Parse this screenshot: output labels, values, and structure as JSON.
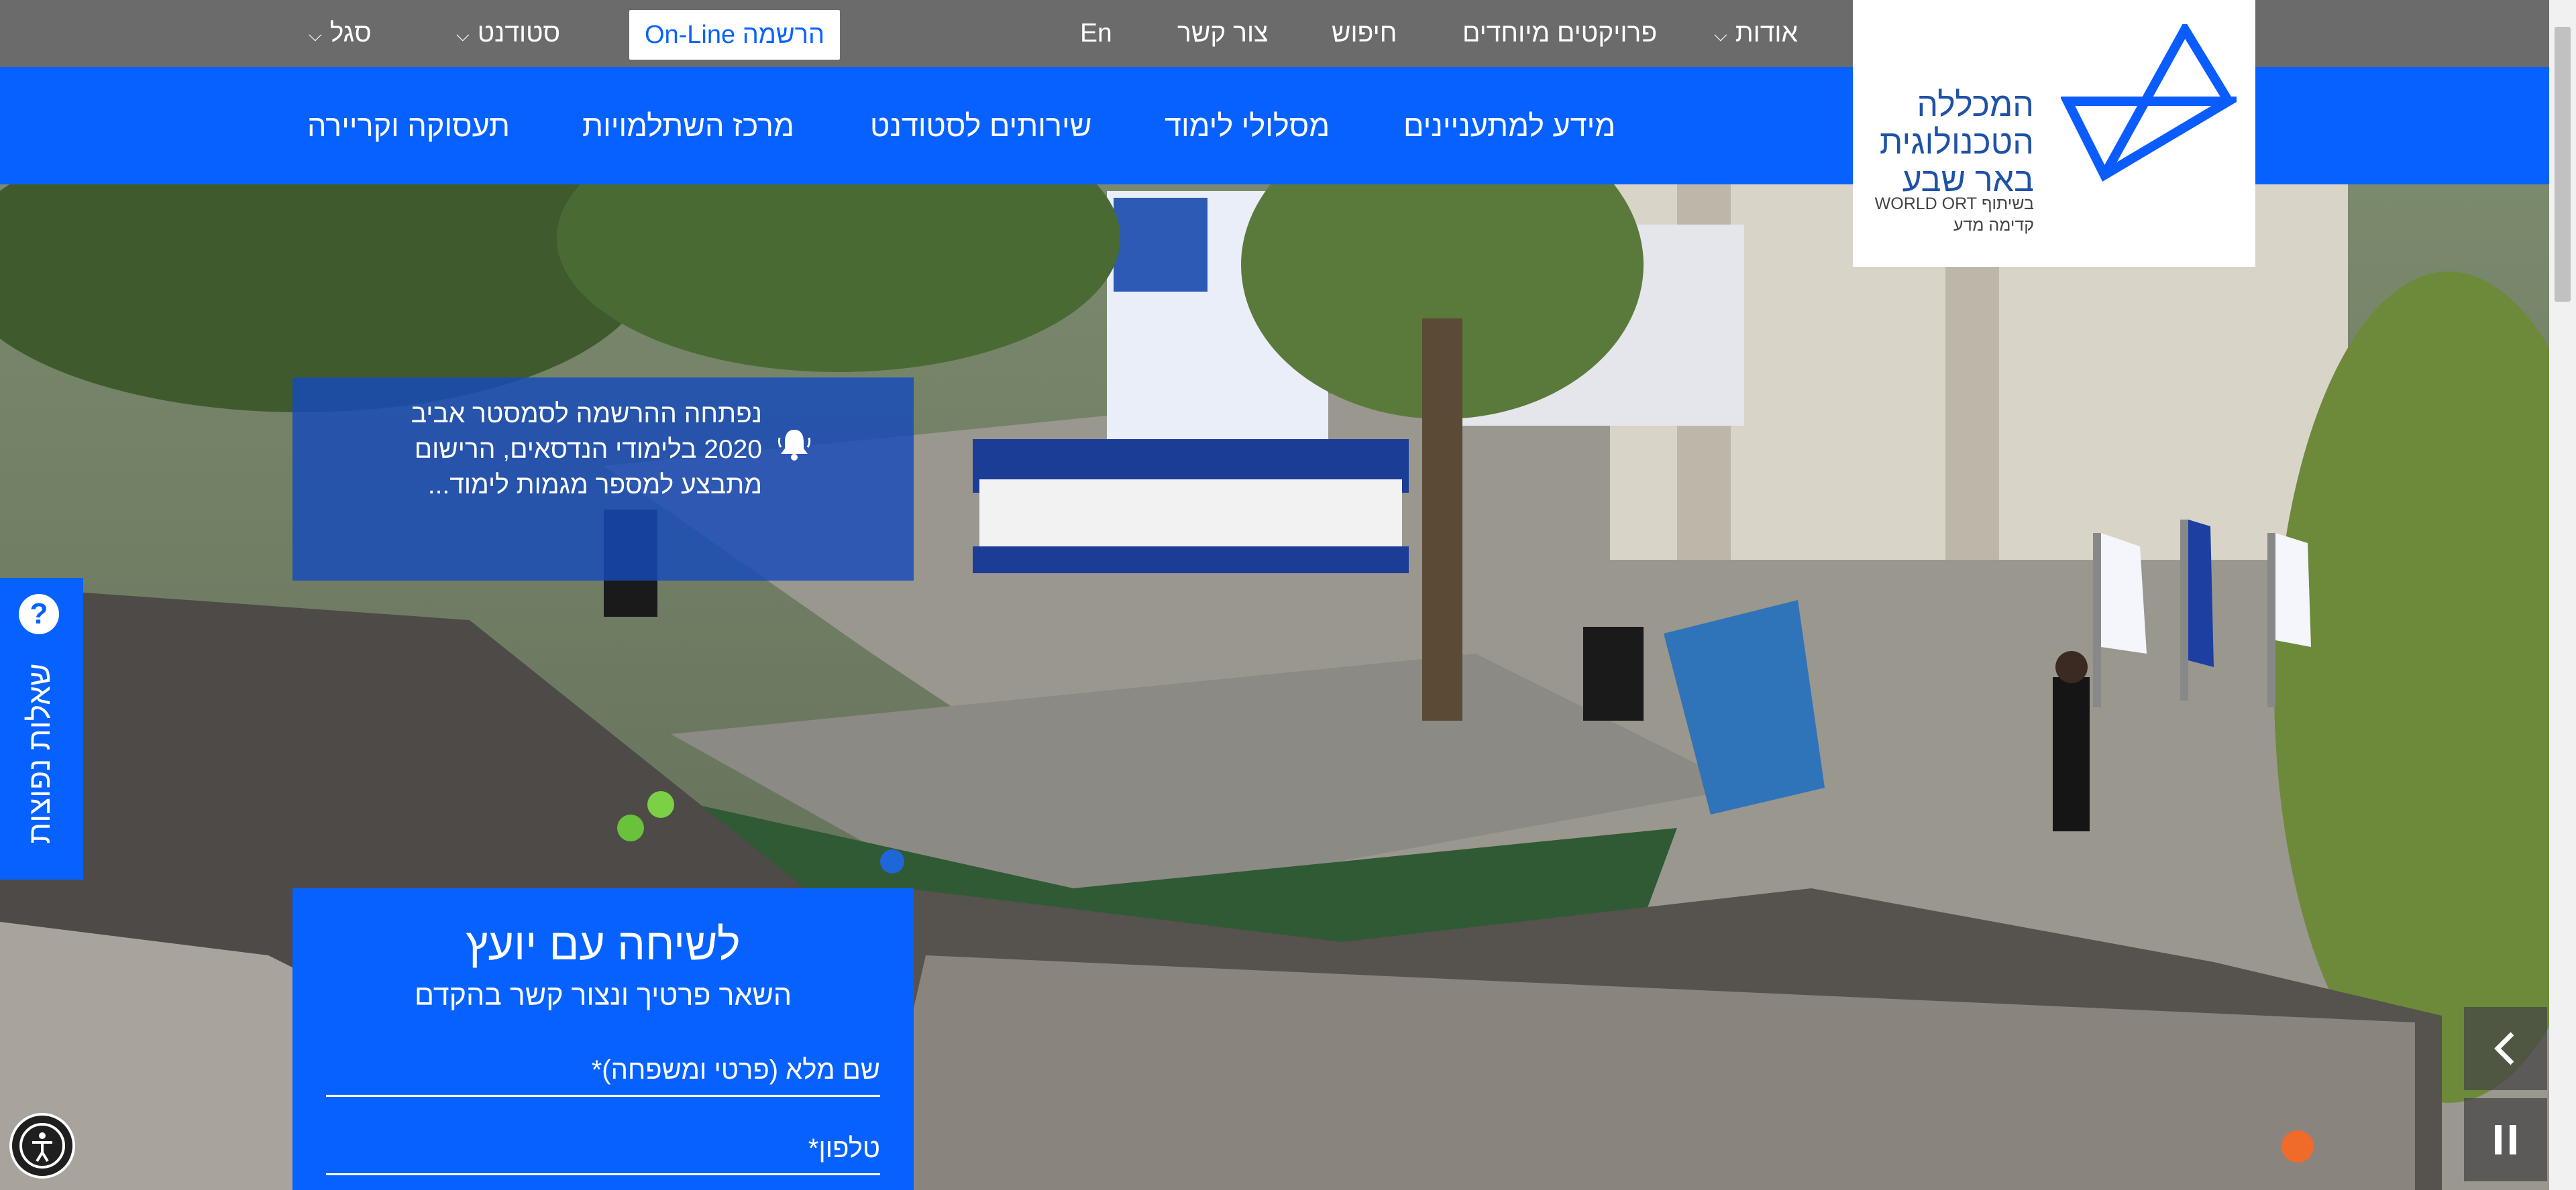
{
  "topbar": {
    "about": "אודות",
    "special_projects": "פרויקטים מיוחדים",
    "search": "חיפוש",
    "contact": "צור קשר",
    "english": "En",
    "online_registration": "הרשמה On-Line",
    "student": "סטודנט",
    "staff": "סגל"
  },
  "nav": {
    "prospective": "מידע למתעניינים",
    "study_tracks": "מסלולי לימוד",
    "student_services": "שירותים לסטודנט",
    "training_center": "מרכז השתלמויות",
    "careers": "תעסוקה וקריירה"
  },
  "logo": {
    "line1": "המכללה",
    "line2": "הטכנולוגית",
    "line3": "באר שבע",
    "partner_line1": "בשיתוף WORLD ORT",
    "partner_line2": "קדימה מדע"
  },
  "announcement": {
    "text": "נפתחה ההרשמה לסמסטר אביב 2020  בלימודי הנדסאים, הרישום מתבצע למספר מגמות לימוד..."
  },
  "faq": {
    "label": "שאלות נפוצות",
    "icon_glyph": "?"
  },
  "contact_form": {
    "title": "לשיחה עם יועץ",
    "subtitle": "השאר פרטיך ונצור קשר בהקדם",
    "name_placeholder": "שם מלא (פרטי ומשפחה)*",
    "phone_placeholder": "טלפון*"
  },
  "colors": {
    "brand_blue": "#0761ff",
    "topbar_grey": "#6b6b6b",
    "logo_blue": "#1f52a6"
  },
  "icons": [
    "bell-icon",
    "question-icon",
    "chevron-left-icon",
    "pause-icon",
    "accessibility-icon",
    "caret-down-icon"
  ]
}
